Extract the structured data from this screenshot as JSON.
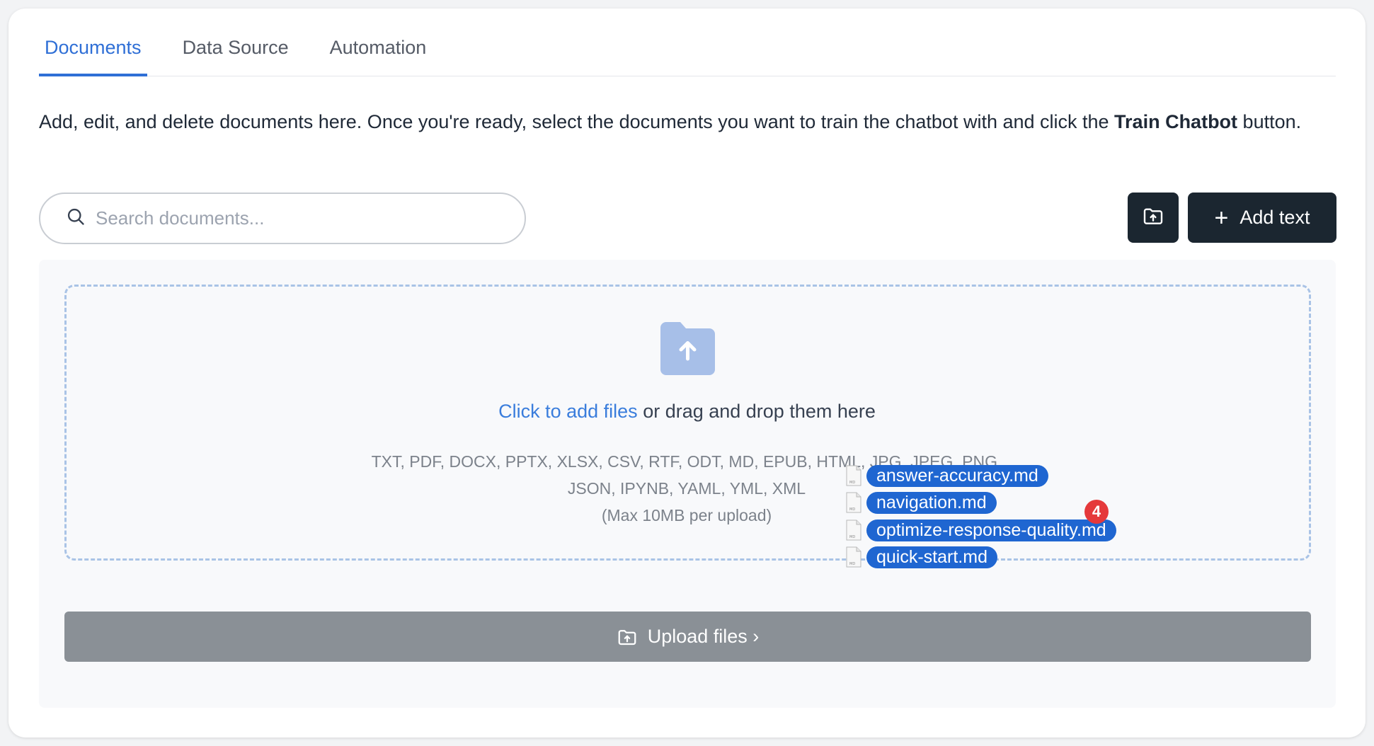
{
  "tabs": [
    {
      "label": "Documents",
      "active": true
    },
    {
      "label": "Data Source",
      "active": false
    },
    {
      "label": "Automation",
      "active": false
    }
  ],
  "description": {
    "before": "Add, edit, and delete documents here. Once you're ready, select the documents you want to train the chatbot with and click the ",
    "bold": "Train Chatbot",
    "after": " button."
  },
  "search": {
    "placeholder": "Search documents..."
  },
  "toolbar": {
    "add_text_label": "Add text",
    "upload_icon": "folder-upload-icon"
  },
  "dropzone": {
    "link_text": "Click to add files",
    "rest_text": " or drag and drop them here",
    "formats_line1": "TXT, PDF, DOCX, PPTX, XLSX, CSV, RTF, ODT, MD, EPUB, HTML, JPG, JPEG, PNG,",
    "formats_line2": "JSON, IPYNB, YAML, YML, XML",
    "max_note": "(Max 10MB per upload)"
  },
  "drag_files": [
    "answer-accuracy.md",
    "navigation.md",
    "optimize-response-quality.md",
    "quick-start.md"
  ],
  "drag_count": "4",
  "upload_button": {
    "label": "Upload files ›"
  },
  "colors": {
    "accent": "#2f6fd6",
    "dark_button": "#1b2630",
    "drag_pill": "#1f66d1",
    "badge": "#e5393b"
  }
}
